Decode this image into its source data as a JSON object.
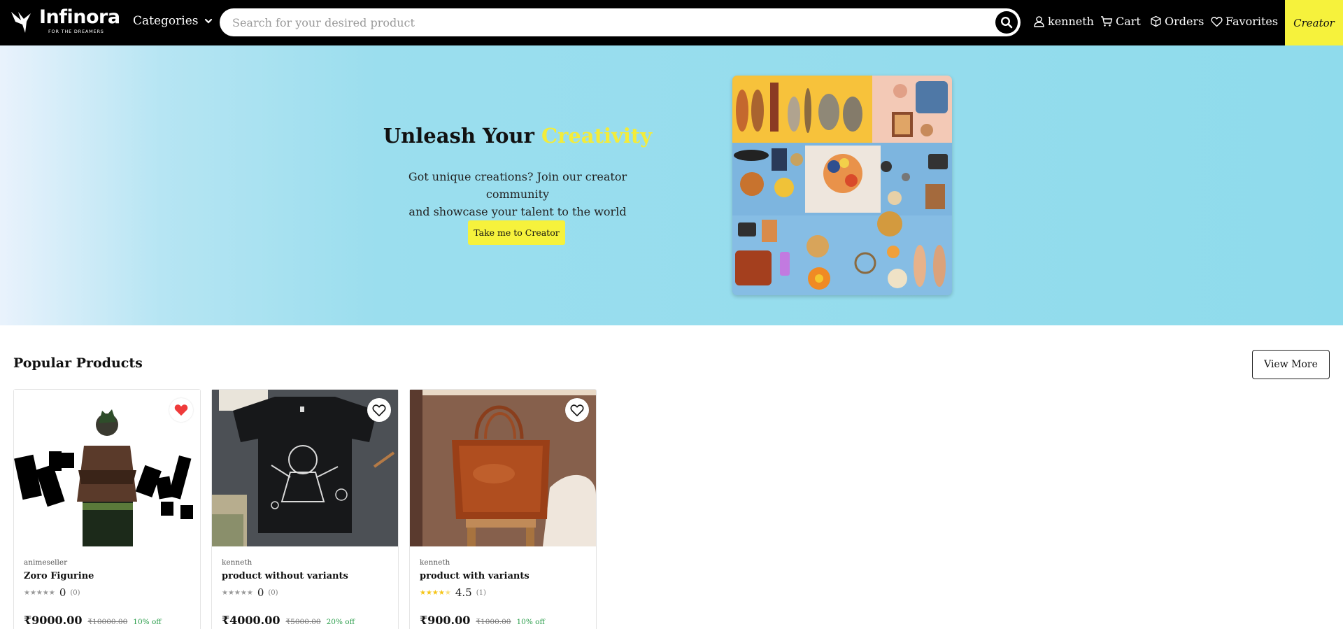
{
  "header": {
    "brand": "Infinora",
    "tagline": "FOR THE DREAMERS",
    "categories_label": "Categories",
    "search": {
      "placeholder": "Search for your desired product",
      "value": ""
    },
    "user_label": "kenneth",
    "cart_label": "Cart",
    "orders_label": "Orders",
    "favorites_label": "Favorites",
    "creator_label": "Creator",
    "icons": [
      "bird-logo-icon",
      "chevron-down-icon",
      "search-icon",
      "user-icon",
      "cart-icon",
      "box-icon",
      "heart-icon"
    ]
  },
  "hero": {
    "title_prefix": "Unleash Your",
    "title_accent": "Creativity",
    "description_line1": "Got unique creations? Join our creator community",
    "description_line2": "and showcase your talent to the world",
    "cta_label": "Take me to Creator"
  },
  "popular": {
    "title": "Popular Products",
    "view_more_label": "View More",
    "products": [
      {
        "seller": "animeseller",
        "name": "Zoro Figurine",
        "stars": 0,
        "rating": "0",
        "reviews": "(0)",
        "price": "₹9000.00",
        "mrp": "₹10000.00",
        "discount": "10% off",
        "favorited": true
      },
      {
        "seller": "kenneth",
        "name": "product without variants",
        "stars": 0,
        "rating": "0",
        "reviews": "(0)",
        "price": "₹4000.00",
        "mrp": "₹5000.00",
        "discount": "20% off",
        "favorited": false
      },
      {
        "seller": "kenneth",
        "name": "product with variants",
        "stars": 4.5,
        "rating": "4.5",
        "reviews": "(1)",
        "price": "₹900.00",
        "mrp": "₹1000.00",
        "discount": "10% off",
        "favorited": false
      }
    ]
  },
  "colors": {
    "header_bg": "#000000",
    "accent_yellow": "#f6f23c",
    "hero_bg": "#8fdbec",
    "discount_green": "#2a9d4a",
    "heart_red": "#ef3b3b",
    "star_gold": "#f5c518"
  }
}
